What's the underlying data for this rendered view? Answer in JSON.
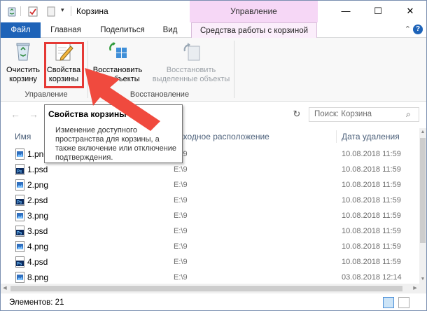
{
  "window": {
    "title": "Корзина",
    "context_header": "Управление",
    "controls": {
      "minimize": "—",
      "maximize": "☐",
      "close": "✕"
    }
  },
  "ribbon_tabs": [
    {
      "label": "Файл"
    },
    {
      "label": "Главная"
    },
    {
      "label": "Поделиться"
    },
    {
      "label": "Вид"
    },
    {
      "label": "Средства работы с корзиной"
    }
  ],
  "ribbon": {
    "empty_bin": {
      "line1": "Очистить",
      "line2": "корзину",
      "icon": "recycle-bin-icon"
    },
    "bin_properties": {
      "line1": "Свойства",
      "line2": "корзины",
      "icon": "properties-icon"
    },
    "restore_all": {
      "line1": "Восстановить",
      "line2": "все объекты",
      "icon": "restore-all-icon"
    },
    "restore_selected": {
      "line1": "Восстановить",
      "line2": "выделенные объекты",
      "icon": "restore-selected-icon"
    },
    "group_manage": "Управление",
    "group_restore": "Восстановление"
  },
  "tooltip": {
    "title": "Свойства корзины",
    "body": "Изменение доступного пространства для корзины, а также включение или отключение подтверждения."
  },
  "navigation": {
    "search_placeholder": "Поиск: Корзина"
  },
  "columns": {
    "name": "Имя",
    "location": "Исходное расположение",
    "date": "Дата удаления"
  },
  "files": [
    {
      "name": "1.png",
      "type": "png",
      "location": "E:\\9",
      "date": "10.08.2018 11:59"
    },
    {
      "name": "1.psd",
      "type": "psd",
      "location": "E:\\9",
      "date": "10.08.2018 11:59"
    },
    {
      "name": "2.png",
      "type": "png",
      "location": "E:\\9",
      "date": "10.08.2018 11:59"
    },
    {
      "name": "2.psd",
      "type": "psd",
      "location": "E:\\9",
      "date": "10.08.2018 11:59"
    },
    {
      "name": "3.png",
      "type": "png",
      "location": "E:\\9",
      "date": "10.08.2018 11:59"
    },
    {
      "name": "3.psd",
      "type": "psd",
      "location": "E:\\9",
      "date": "10.08.2018 11:59"
    },
    {
      "name": "4.png",
      "type": "png",
      "location": "E:\\9",
      "date": "10.08.2018 11:59"
    },
    {
      "name": "4.psd",
      "type": "psd",
      "location": "E:\\9",
      "date": "10.08.2018 11:59"
    },
    {
      "name": "8.png",
      "type": "png",
      "location": "E:\\9",
      "date": "03.08.2018 12:14"
    }
  ],
  "status": {
    "items_count": "Элементов: 21"
  },
  "colors": {
    "file_tab": "#1e63b8",
    "context_band": "#f6d7f6",
    "highlight": "#e53935",
    "arrow": "#f04a3e",
    "psd_icon": "#0a2a5e"
  }
}
